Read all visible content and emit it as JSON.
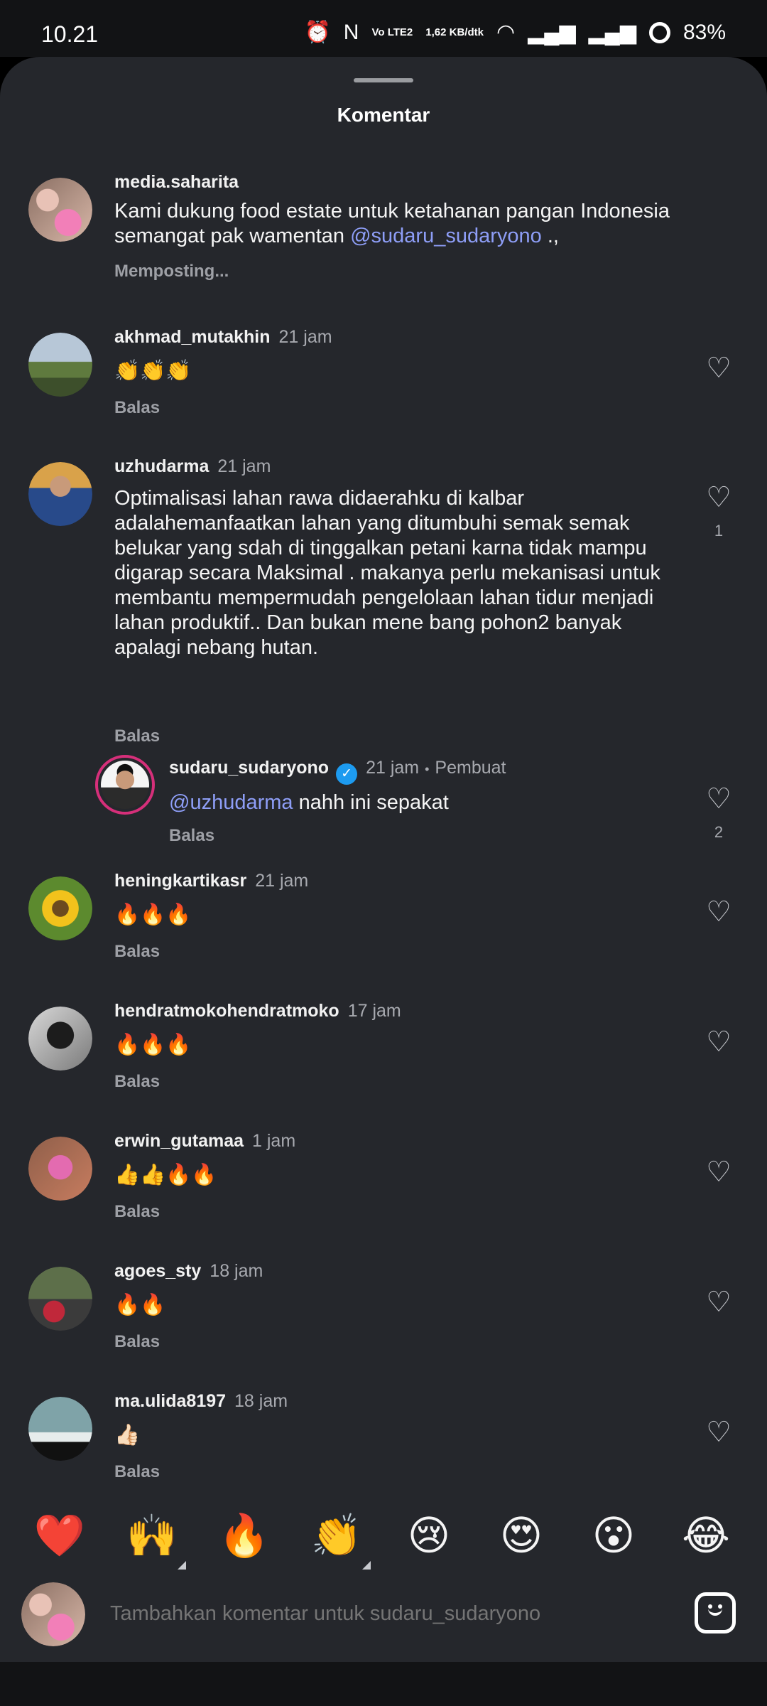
{
  "status": {
    "time": "10.21",
    "volte": "Vo LTE2",
    "net_speed": "1,62 KB/dtk",
    "battery": "83%"
  },
  "sheet": {
    "title": "Komentar"
  },
  "comments": [
    {
      "username": "media.saharita",
      "time": "",
      "text": "Kami dukung food estate untuk ketahanan pangan Indonesia semangat pak wamentan",
      "mention": "@sudaru_sudaryono",
      "text_after": " .,",
      "action": "Memposting...",
      "likes": ""
    },
    {
      "username": "akhmad_mutakhin",
      "time": "21 jam",
      "text": "👏👏👏",
      "action": "Balas",
      "likes": ""
    },
    {
      "username": "uzhudarma",
      "time": "21 jam",
      "text": "Optimalisasi lahan rawa didaerahku di kalbar adalahemanfaatkan lahan yang ditumbuhi semak semak belukar yang sdah di tinggalkan petani karna tidak mampu digarap secara Maksimal . makanya perlu mekanisasi untuk membantu mempermudah pengelolaan lahan  tidur menjadi lahan produktif.. Dan bukan mene bang pohon2 banyak apalagi nebang hutan.",
      "action": "Balas",
      "likes": "1"
    },
    {
      "username": "sudaru_sudaryono",
      "time": "21 jam",
      "creator_label": "Pembuat",
      "mention": "@uzhudarma",
      "text": " nahh ini sepakat",
      "action": "Balas",
      "likes": "2"
    },
    {
      "username": "heningkartikasr",
      "time": "21 jam",
      "text": "🔥🔥🔥",
      "action": "Balas",
      "likes": ""
    },
    {
      "username": "hendratmokohendratmoko",
      "time": "17 jam",
      "text": "🔥🔥🔥",
      "action": "Balas",
      "likes": ""
    },
    {
      "username": "erwin_gutamaa",
      "time": "1 jam",
      "text": "👍👍🔥🔥",
      "action": "Balas",
      "likes": ""
    },
    {
      "username": "agoes_sty",
      "time": "18 jam",
      "text": "🔥🔥",
      "action": "Balas",
      "likes": ""
    },
    {
      "username": "ma.ulida8197",
      "time": "18 jam",
      "text": "👍🏻",
      "action": "Balas",
      "likes": ""
    }
  ],
  "emoji_bar": [
    "❤️",
    "🙌",
    "🔥",
    "👏",
    "😢",
    "😍",
    "😮",
    "😂"
  ],
  "composer": {
    "placeholder": "Tambahkan komentar untuk sudaru_sudaryono"
  },
  "icons": {
    "heart": "heart-outline-icon",
    "sticker": "sticker-icon",
    "verified": "verified-badge-icon"
  },
  "colors": {
    "background": "#25272c",
    "mention": "#8e9ef7",
    "verified": "#1d9bf0",
    "story_ring": "#d62f7a"
  }
}
